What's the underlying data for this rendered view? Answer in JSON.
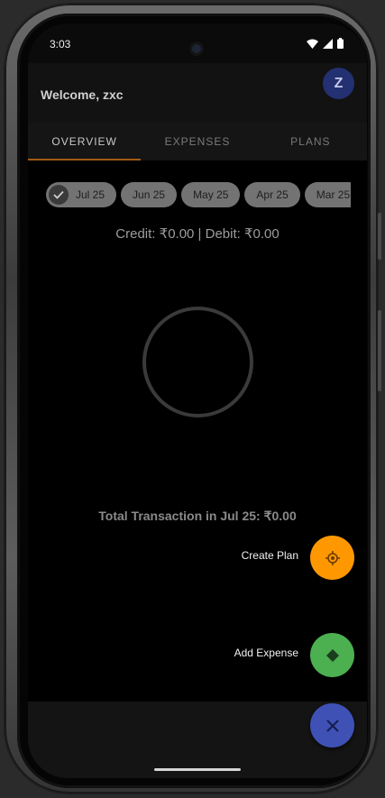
{
  "status_bar": {
    "time": "3:03"
  },
  "header": {
    "welcome": "Welcome, zxc",
    "avatar_letter": "Z"
  },
  "tabs": [
    {
      "label": "OVERVIEW",
      "active": true
    },
    {
      "label": "EXPENSES",
      "active": false
    },
    {
      "label": "PLANS",
      "active": false
    }
  ],
  "months": {
    "selected": "Jul 25",
    "chips": [
      "Jul 25",
      "Jun 25",
      "May 25",
      "Apr 25",
      "Mar 25"
    ]
  },
  "summary": "Credit: ₹0.00 | Debit: ₹0.00",
  "total": "Total Transaction in Jul 25: ₹0.00",
  "fab_menu": {
    "create_plan": {
      "label": "Create Plan",
      "color": "#ff9800",
      "icon": "plan-crosshair-icon"
    },
    "add_expense": {
      "label": "Add Expense",
      "color": "#4caf50",
      "icon": "expense-diamond-icon"
    },
    "close": {
      "color": "#3f51b5",
      "icon": "close-icon"
    }
  },
  "colors": {
    "tab_indicator": "#a15c14",
    "chip_bg": "#737373",
    "avatar_bg": "#233071"
  }
}
